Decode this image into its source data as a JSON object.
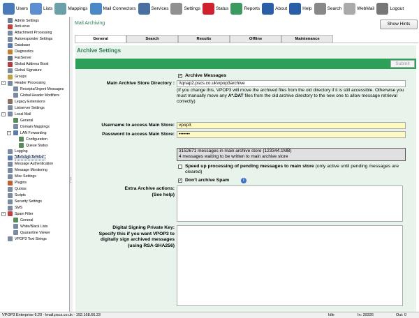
{
  "toolbar": {
    "items": [
      {
        "label": "Users",
        "icon": "users-icon",
        "color": "#4a7ab8"
      },
      {
        "label": "Lists",
        "icon": "lists-icon",
        "color": "#5b8fd0"
      },
      {
        "label": "Mappings",
        "icon": "mappings-icon",
        "color": "#6aa0a8"
      },
      {
        "label": "Mail Connectors",
        "icon": "mail-connectors-icon",
        "color": "#4a88c8"
      },
      {
        "label": "Services",
        "icon": "services-icon",
        "color": "#4a70a0"
      },
      {
        "label": "Settings",
        "icon": "settings-icon",
        "color": "#909090"
      },
      {
        "label": "Status",
        "icon": "status-icon",
        "color": "#d02030"
      },
      {
        "label": "Reports",
        "icon": "reports-icon",
        "color": "#3c9a60"
      },
      {
        "label": "About",
        "icon": "about-icon",
        "color": "#2a5fa8"
      },
      {
        "label": "Help",
        "icon": "help-icon",
        "color": "#2a5fa8"
      },
      {
        "label": "Search",
        "icon": "search-icon",
        "color": "#888888"
      },
      {
        "label": "WebMail",
        "icon": "webmail-icon",
        "color": "#aaaaaa"
      },
      {
        "label": "Logout",
        "icon": "logout-icon",
        "color": "#777777"
      }
    ]
  },
  "sidebar": {
    "items": [
      {
        "label": "Admin Settings",
        "icon": "admin-settings-icon",
        "color": "#6a7f9a"
      },
      {
        "label": "Anti-virus",
        "icon": "anti-virus-icon",
        "color": "#c04040"
      },
      {
        "label": "Attachment Processing",
        "icon": "attachment-icon",
        "color": "#7a8aa0"
      },
      {
        "label": "Autoresponder Settings",
        "icon": "autoresponder-icon",
        "color": "#7a8aa0"
      },
      {
        "label": "Database",
        "icon": "database-icon",
        "color": "#5a7ab0"
      },
      {
        "label": "Diagnostics",
        "icon": "diagnostics-icon",
        "color": "#c08030"
      },
      {
        "label": "FaxServer",
        "icon": "fax-icon",
        "color": "#607080"
      },
      {
        "label": "Global Address Book",
        "icon": "address-book-icon",
        "color": "#b04040"
      },
      {
        "label": "Global Signature",
        "icon": "signature-icon",
        "color": "#7a8aa0"
      },
      {
        "label": "Groups",
        "icon": "groups-icon",
        "color": "#c0a040"
      },
      {
        "label": "Header Processing",
        "icon": "header-processing-icon",
        "color": "#7a8aa0"
      },
      {
        "label": "Receipts/Urgent Messages",
        "icon": "receipts-icon",
        "color": "#7a8aa0"
      },
      {
        "label": "Global Header Modifiers",
        "icon": "header-modifiers-icon",
        "color": "#7a8aa0"
      },
      {
        "label": "Legacy Extensions",
        "icon": "legacy-extensions-icon",
        "color": "#8a7060"
      },
      {
        "label": "Listserver Settings",
        "icon": "listserver-icon",
        "color": "#7a8aa0"
      },
      {
        "label": "Local Mail",
        "icon": "local-mail-icon",
        "color": "#7a8aa0"
      },
      {
        "label": "General",
        "icon": "general-icon",
        "color": "#5a8a5a"
      },
      {
        "label": "Domain Mappings",
        "icon": "domain-mappings-icon",
        "color": "#7a8aa0"
      },
      {
        "label": "LAN Forwarding",
        "icon": "lan-forwarding-icon",
        "color": "#5a7ab0"
      },
      {
        "label": "Configuration",
        "icon": "configuration-icon",
        "color": "#5a8a5a"
      },
      {
        "label": "Queue Status",
        "icon": "queue-status-icon",
        "color": "#5a8a5a"
      },
      {
        "label": "Logging",
        "icon": "logging-icon",
        "color": "#7a8aa0"
      },
      {
        "label": "Message Archive",
        "icon": "message-archive-icon",
        "color": "#5a7ab0"
      },
      {
        "label": "Message Authentication",
        "icon": "message-authentication-icon",
        "color": "#7a8aa0"
      },
      {
        "label": "Message Monitoring",
        "icon": "message-monitoring-icon",
        "color": "#7a8aa0"
      },
      {
        "label": "Misc Settings",
        "icon": "misc-settings-icon",
        "color": "#7a8aa0"
      },
      {
        "label": "Plugins",
        "icon": "plugins-icon",
        "color": "#c06030"
      },
      {
        "label": "Quotas",
        "icon": "quotas-icon",
        "color": "#7a8aa0"
      },
      {
        "label": "Scripts",
        "icon": "scripts-icon",
        "color": "#7a8aa0"
      },
      {
        "label": "Security Settings",
        "icon": "security-settings-icon",
        "color": "#7a8aa0"
      },
      {
        "label": "SMS",
        "icon": "sms-icon",
        "color": "#7a8aa0"
      },
      {
        "label": "Spam Filter",
        "icon": "spam-filter-icon",
        "color": "#c04040"
      },
      {
        "label": "General",
        "icon": "general-icon",
        "color": "#5a8a5a"
      },
      {
        "label": "White/Black Lists",
        "icon": "white-black-lists-icon",
        "color": "#7a8aa0"
      },
      {
        "label": "Quarantine Viewer",
        "icon": "quarantine-viewer-icon",
        "color": "#7a8aa0"
      },
      {
        "label": "VPOP3 Text Strings",
        "icon": "text-strings-icon",
        "color": "#7a8aa0"
      }
    ],
    "toggles": [
      "-",
      "-",
      "-",
      "-"
    ]
  },
  "main": {
    "title": "Mail Archiving",
    "hints_button": "Show Hints",
    "tabs": [
      "General",
      "Search",
      "Results",
      "Offline",
      "Maintenance"
    ],
    "section_title": "Archive Settings",
    "submit_label": "Submit",
    "archive_messages": {
      "checked": true,
      "label": "Archive Messages"
    },
    "main_store_dir": {
      "label": "Main Archive Store Directory :",
      "value": "\\\\qnap2.pscs.co.uk\\vpop3archive"
    },
    "dir_note": {
      "pre": "(If you change this, VPOP3 will move the archived files from the old directory if it is still accessible. Otherwise you must manually move any ",
      "bold": "A*.DAT",
      "post": " files from the old archive directory to the new one to allow message retrieval correctly)"
    },
    "username": {
      "label": "Username to access Main Store:",
      "value": "vpop3"
    },
    "password": {
      "label": "Password to access Main Store:",
      "value": "•••••••"
    },
    "status_line1": "3152671 messages in main archive store (123344.1MB)",
    "status_line2": "4 messages waiting to be written to main archive store",
    "speed_up": {
      "checked": false,
      "bold": "Speed up processing of pending messages to main store",
      "rest": " (only active until pending messages are cleared)"
    },
    "dont_archive_spam": {
      "checked": true,
      "label": "Don't archive Spam"
    },
    "extra_actions": {
      "line1": "Extra Archive actions:",
      "line2": "(See help)"
    },
    "signing": {
      "line1": "Digital Signing Private Key:",
      "line2": "Specify this if you want VPOP3 to",
      "line3": "digitally sign archived messages",
      "line4": "(using RSA-SHA256)"
    }
  },
  "statusbar": {
    "version": "VPOP3 Enterprise 6.20 - lmail.pscs.co.uk - 192.168.66.23",
    "state": "Idle",
    "in": "In: 39326",
    "out": "Out: 0"
  }
}
